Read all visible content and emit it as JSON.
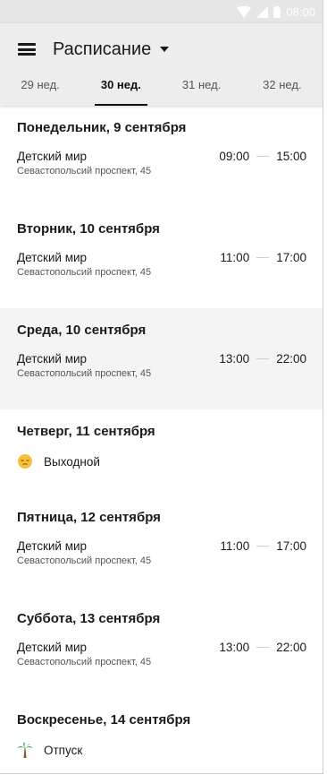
{
  "status_bar": {
    "time": "08:00"
  },
  "header": {
    "title": "Расписание"
  },
  "tabs": [
    {
      "label": "29 нед.",
      "active": false
    },
    {
      "label": "30 нед.",
      "active": true
    },
    {
      "label": "31 нед.",
      "active": false
    },
    {
      "label": "32 нед.",
      "active": false
    }
  ],
  "days": [
    {
      "title": "Понедельник, 9 сентября",
      "place": "Детский мир",
      "address": "Севастопольсий проспект, 45",
      "start": "09:00",
      "end": "15:00"
    },
    {
      "title": "Вторник, 10 сентября",
      "place": "Детский мир",
      "address": "Севастопольсий проспект, 45",
      "start": "11:00",
      "end": "17:00"
    },
    {
      "title": "Среда, 10 сентября",
      "place": "Детский мир",
      "address": "Севастопольсий проспект, 45",
      "start": "13:00",
      "end": "22:00"
    },
    {
      "title": "Четверг, 11 сентября",
      "status": "Выходной",
      "status_icon": "sleepy-face-icon"
    },
    {
      "title": "Пятница, 12 сентября",
      "place": "Детский мир",
      "address": "Севастопольсий проспект, 45",
      "start": "11:00",
      "end": "17:00"
    },
    {
      "title": "Суббота, 13 сентября",
      "place": "Детский мир",
      "address": "Севастопольсий проспект, 45",
      "start": "13:00",
      "end": "22:00"
    },
    {
      "title": "Воскресенье, 14 сентября",
      "status": "Отпуск",
      "status_icon": "palm-tree-icon"
    }
  ],
  "colors": {
    "appbar": "#ededed",
    "highlight_row": "#f4f4f4",
    "active_tab": "#111111"
  }
}
